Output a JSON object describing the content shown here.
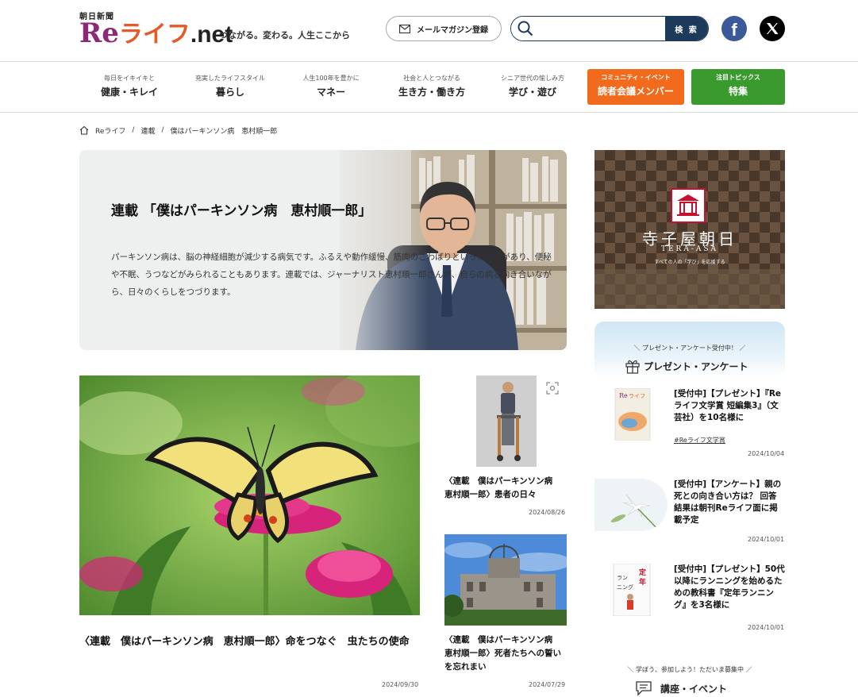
{
  "header": {
    "paper_name": "朝日新聞",
    "logo_re": "Re",
    "logo_life": "ライフ",
    "logo_net": ".net",
    "tagline": "つながる。変わる。人生ここから",
    "newsletter_label": "メールマガジン登録",
    "search_placeholder": "",
    "search_button": "検 索",
    "facebook_glyph": "f",
    "x_glyph": "X"
  },
  "nav": {
    "items": [
      {
        "sub": "毎日をイキイキと",
        "label": "健康・キレイ"
      },
      {
        "sub": "充実したライフスタイル",
        "label": "暮らし"
      },
      {
        "sub": "人生100年を豊かに",
        "label": "マネー"
      },
      {
        "sub": "社会と人とつながる",
        "label": "生き方・働き方"
      },
      {
        "sub": "シニア世代の愉しみ方",
        "label": "学び・遊び"
      }
    ],
    "community": {
      "sub": "コミュニティ・イベント",
      "label": "読者会議メンバー",
      "color": "#f26b1d"
    },
    "topics": {
      "sub": "注目トピックス",
      "label": "特集",
      "color": "#3a9a2e"
    }
  },
  "breadcrumb": {
    "home": "Reライフ",
    "sep": "/",
    "category": "連載",
    "current": "僕はパーキンソン病　恵村順一郎"
  },
  "hero": {
    "title": "連載 「僕はパーキンソン病　恵村順一郎」",
    "description": "パーキンソン病は、脳の神経細胞が減少する病気です。ふるえや動作緩慢、筋肉のこわばりといった症状があり、便秘や不眠、うつなどがみられることもあります。連載では、ジャーナリスト恵村順一郎さんが、自らの病と向き合いながら、日々のくらしをつづります。"
  },
  "articles": [
    {
      "title": "〈連載　僕はパーキンソン病　恵村順一郎〉命をつなぐ　虫たちの使命",
      "date": "2024/09/30"
    },
    {
      "title": "〈連載　僕はパーキンソン病　恵村順一郎〉患者の日々",
      "date": "2024/08/26"
    },
    {
      "title": "〈連載　僕はパーキンソン病　恵村順一郎〉死者たちへの誓いを忘れまい",
      "date": "2024/07/29"
    }
  ],
  "sidebar": {
    "tera": {
      "title": "寺子屋朝日",
      "roman": "TERA-ASA",
      "tagline": "すべての人の「学び」を応援する"
    },
    "present": {
      "banner": "＼ プレゼント・アンケート受付中！ ／",
      "heading": "プレゼント・アンケート",
      "items": [
        {
          "title": "[受付中]【プレゼント】『Reライフ文学賞 短編集3』（文芸社）を10名様に",
          "tag": "#Reライフ文学賞",
          "date": "2024/10/04"
        },
        {
          "title": "[受付中]【アンケート】親の死との向き合い方は？ 回答結果は朝刊Reライフ面に掲載予定",
          "tag": "",
          "date": "2024/10/01"
        },
        {
          "title": "[受付中]【プレゼント】50代以降にランニングを始めるための教科書『定年ランニング』を3名様に",
          "tag": "",
          "date": "2024/10/01"
        }
      ]
    },
    "events": {
      "banner": "＼ 学ぼう、参加しよう！ただいま募集中 ／",
      "heading": "講座・イベント"
    }
  }
}
